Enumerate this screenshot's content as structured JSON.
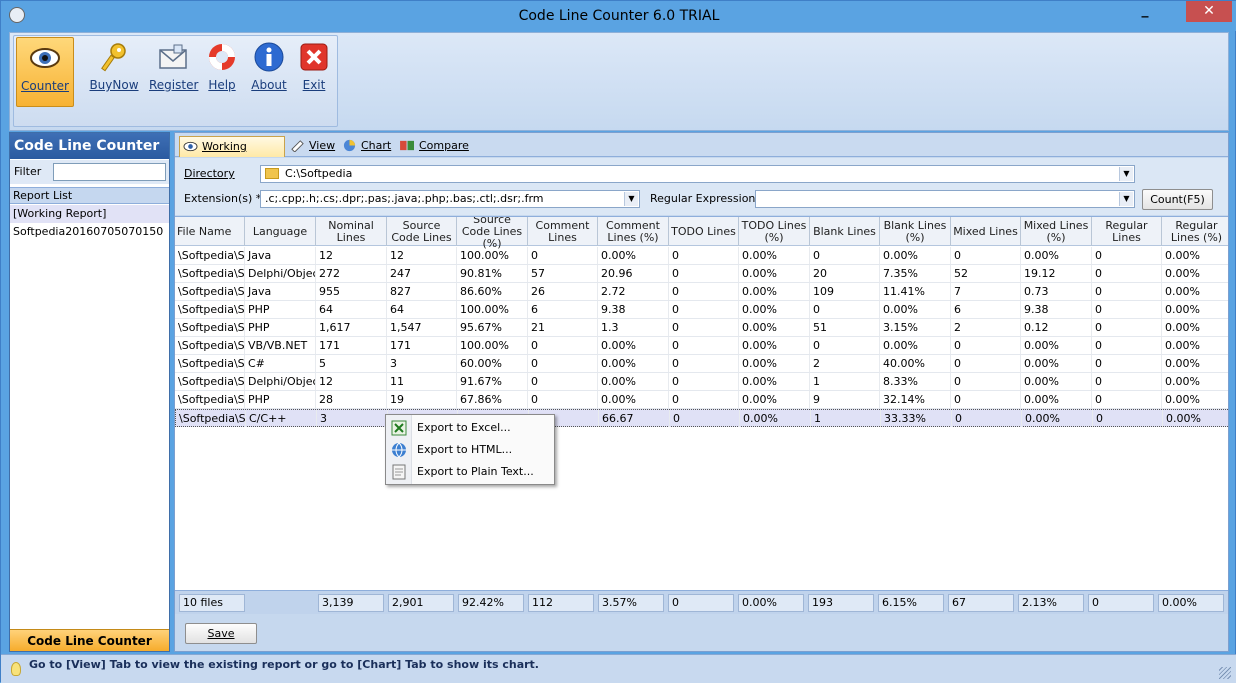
{
  "window": {
    "title": "Code Line Counter 6.0 TRIAL",
    "minimize": "_",
    "close": "✕"
  },
  "ribbon": {
    "buttons": [
      {
        "label": "Counter",
        "icon": "eye-icon"
      },
      {
        "label": "BuyNow",
        "icon": "key-icon"
      },
      {
        "label": "Register",
        "icon": "envelope-icon"
      },
      {
        "label": "Help",
        "icon": "lifebuoy-icon"
      },
      {
        "label": "About",
        "icon": "info-icon"
      },
      {
        "label": "Exit",
        "icon": "exit-x-icon"
      }
    ]
  },
  "left_panel": {
    "title": "Code Line Counter",
    "filter_label": "Filter",
    "filter_value": "",
    "list_header": "Report List",
    "items": [
      "[Working Report]",
      "Softpedia20160705070150"
    ],
    "footer": "Code Line Counter"
  },
  "tabs": [
    {
      "label": "Working Report",
      "icon": "eye-icon"
    },
    {
      "label": "View",
      "icon": "pencil-icon"
    },
    {
      "label": "Chart",
      "icon": "chart-icon"
    },
    {
      "label": "Compare",
      "icon": "compare-icon"
    }
  ],
  "form": {
    "directory_label": "Directory",
    "directory_value": "C:\\Softpedia",
    "extensions_label": "Extension(s) *",
    "extensions_value": ".c;.cpp;.h;.cs;.dpr;.pas;.java;.php;.bas;.ctl;.dsr;.frm",
    "regex_label": "Regular Expression",
    "regex_value": "",
    "count_button": "Count(F5)"
  },
  "grid": {
    "columns": [
      "File Name",
      "Language",
      "Nominal Lines",
      "Source Code Lines",
      "Source Code Lines (%)",
      "Comment Lines",
      "Comment Lines (%)",
      "TODO Lines",
      "TODO Lines (%)",
      "Blank Lines",
      "Blank Lines (%)",
      "Mixed Lines",
      "Mixed Lines (%)",
      "Regular Lines",
      "Regular Lines (%)"
    ],
    "rows": [
      [
        "\\Softpedia\\So",
        "Java",
        "12",
        "12",
        "100.00%",
        "0",
        "0.00%",
        "0",
        "0.00%",
        "0",
        "0.00%",
        "0",
        "0.00%",
        "0",
        "0.00%"
      ],
      [
        "\\Softpedia\\So",
        "Delphi/Object",
        "272",
        "247",
        "90.81%",
        "57",
        "20.96",
        "0",
        "0.00%",
        "20",
        "7.35%",
        "52",
        "19.12",
        "0",
        "0.00%"
      ],
      [
        "\\Softpedia\\So",
        "Java",
        "955",
        "827",
        "86.60%",
        "26",
        "2.72",
        "0",
        "0.00%",
        "109",
        "11.41%",
        "7",
        "0.73",
        "0",
        "0.00%"
      ],
      [
        "\\Softpedia\\So",
        "PHP",
        "64",
        "64",
        "100.00%",
        "6",
        "9.38",
        "0",
        "0.00%",
        "0",
        "0.00%",
        "6",
        "9.38",
        "0",
        "0.00%"
      ],
      [
        "\\Softpedia\\So",
        "PHP",
        "1,617",
        "1,547",
        "95.67%",
        "21",
        "1.3",
        "0",
        "0.00%",
        "51",
        "3.15%",
        "2",
        "0.12",
        "0",
        "0.00%"
      ],
      [
        "\\Softpedia\\So",
        "VB/VB.NET",
        "171",
        "171",
        "100.00%",
        "0",
        "0.00%",
        "0",
        "0.00%",
        "0",
        "0.00%",
        "0",
        "0.00%",
        "0",
        "0.00%"
      ],
      [
        "\\Softpedia\\So",
        "C#",
        "5",
        "3",
        "60.00%",
        "0",
        "0.00%",
        "0",
        "0.00%",
        "2",
        "40.00%",
        "0",
        "0.00%",
        "0",
        "0.00%"
      ],
      [
        "\\Softpedia\\So",
        "Delphi/Object",
        "12",
        "11",
        "91.67%",
        "0",
        "0.00%",
        "0",
        "0.00%",
        "1",
        "8.33%",
        "0",
        "0.00%",
        "0",
        "0.00%"
      ],
      [
        "\\Softpedia\\So",
        "PHP",
        "28",
        "19",
        "67.86%",
        "0",
        "0.00%",
        "0",
        "0.00%",
        "9",
        "32.14%",
        "0",
        "0.00%",
        "0",
        "0.00%"
      ],
      [
        "\\Softpedia\\So",
        "C/C++",
        "3",
        "",
        "",
        "",
        "66.67",
        "0",
        "0.00%",
        "1",
        "33.33%",
        "0",
        "0.00%",
        "0",
        "0.00%"
      ]
    ],
    "totals": [
      "10 files",
      "3,139",
      "2,901",
      "92.42%",
      "112",
      "3.57%",
      "0",
      "0.00%",
      "193",
      "6.15%",
      "67",
      "2.13%",
      "0",
      "0.00%"
    ]
  },
  "save_button": "Save",
  "status": "Go to [View] Tab to view the existing report or go to [Chart] Tab to show its chart.",
  "context_menu": {
    "items": [
      {
        "label": "Export to Excel...",
        "icon": "excel-icon"
      },
      {
        "label": "Export to HTML...",
        "icon": "html-globe-icon"
      },
      {
        "label": "Export to Plain Text...",
        "icon": "text-file-icon"
      }
    ]
  }
}
